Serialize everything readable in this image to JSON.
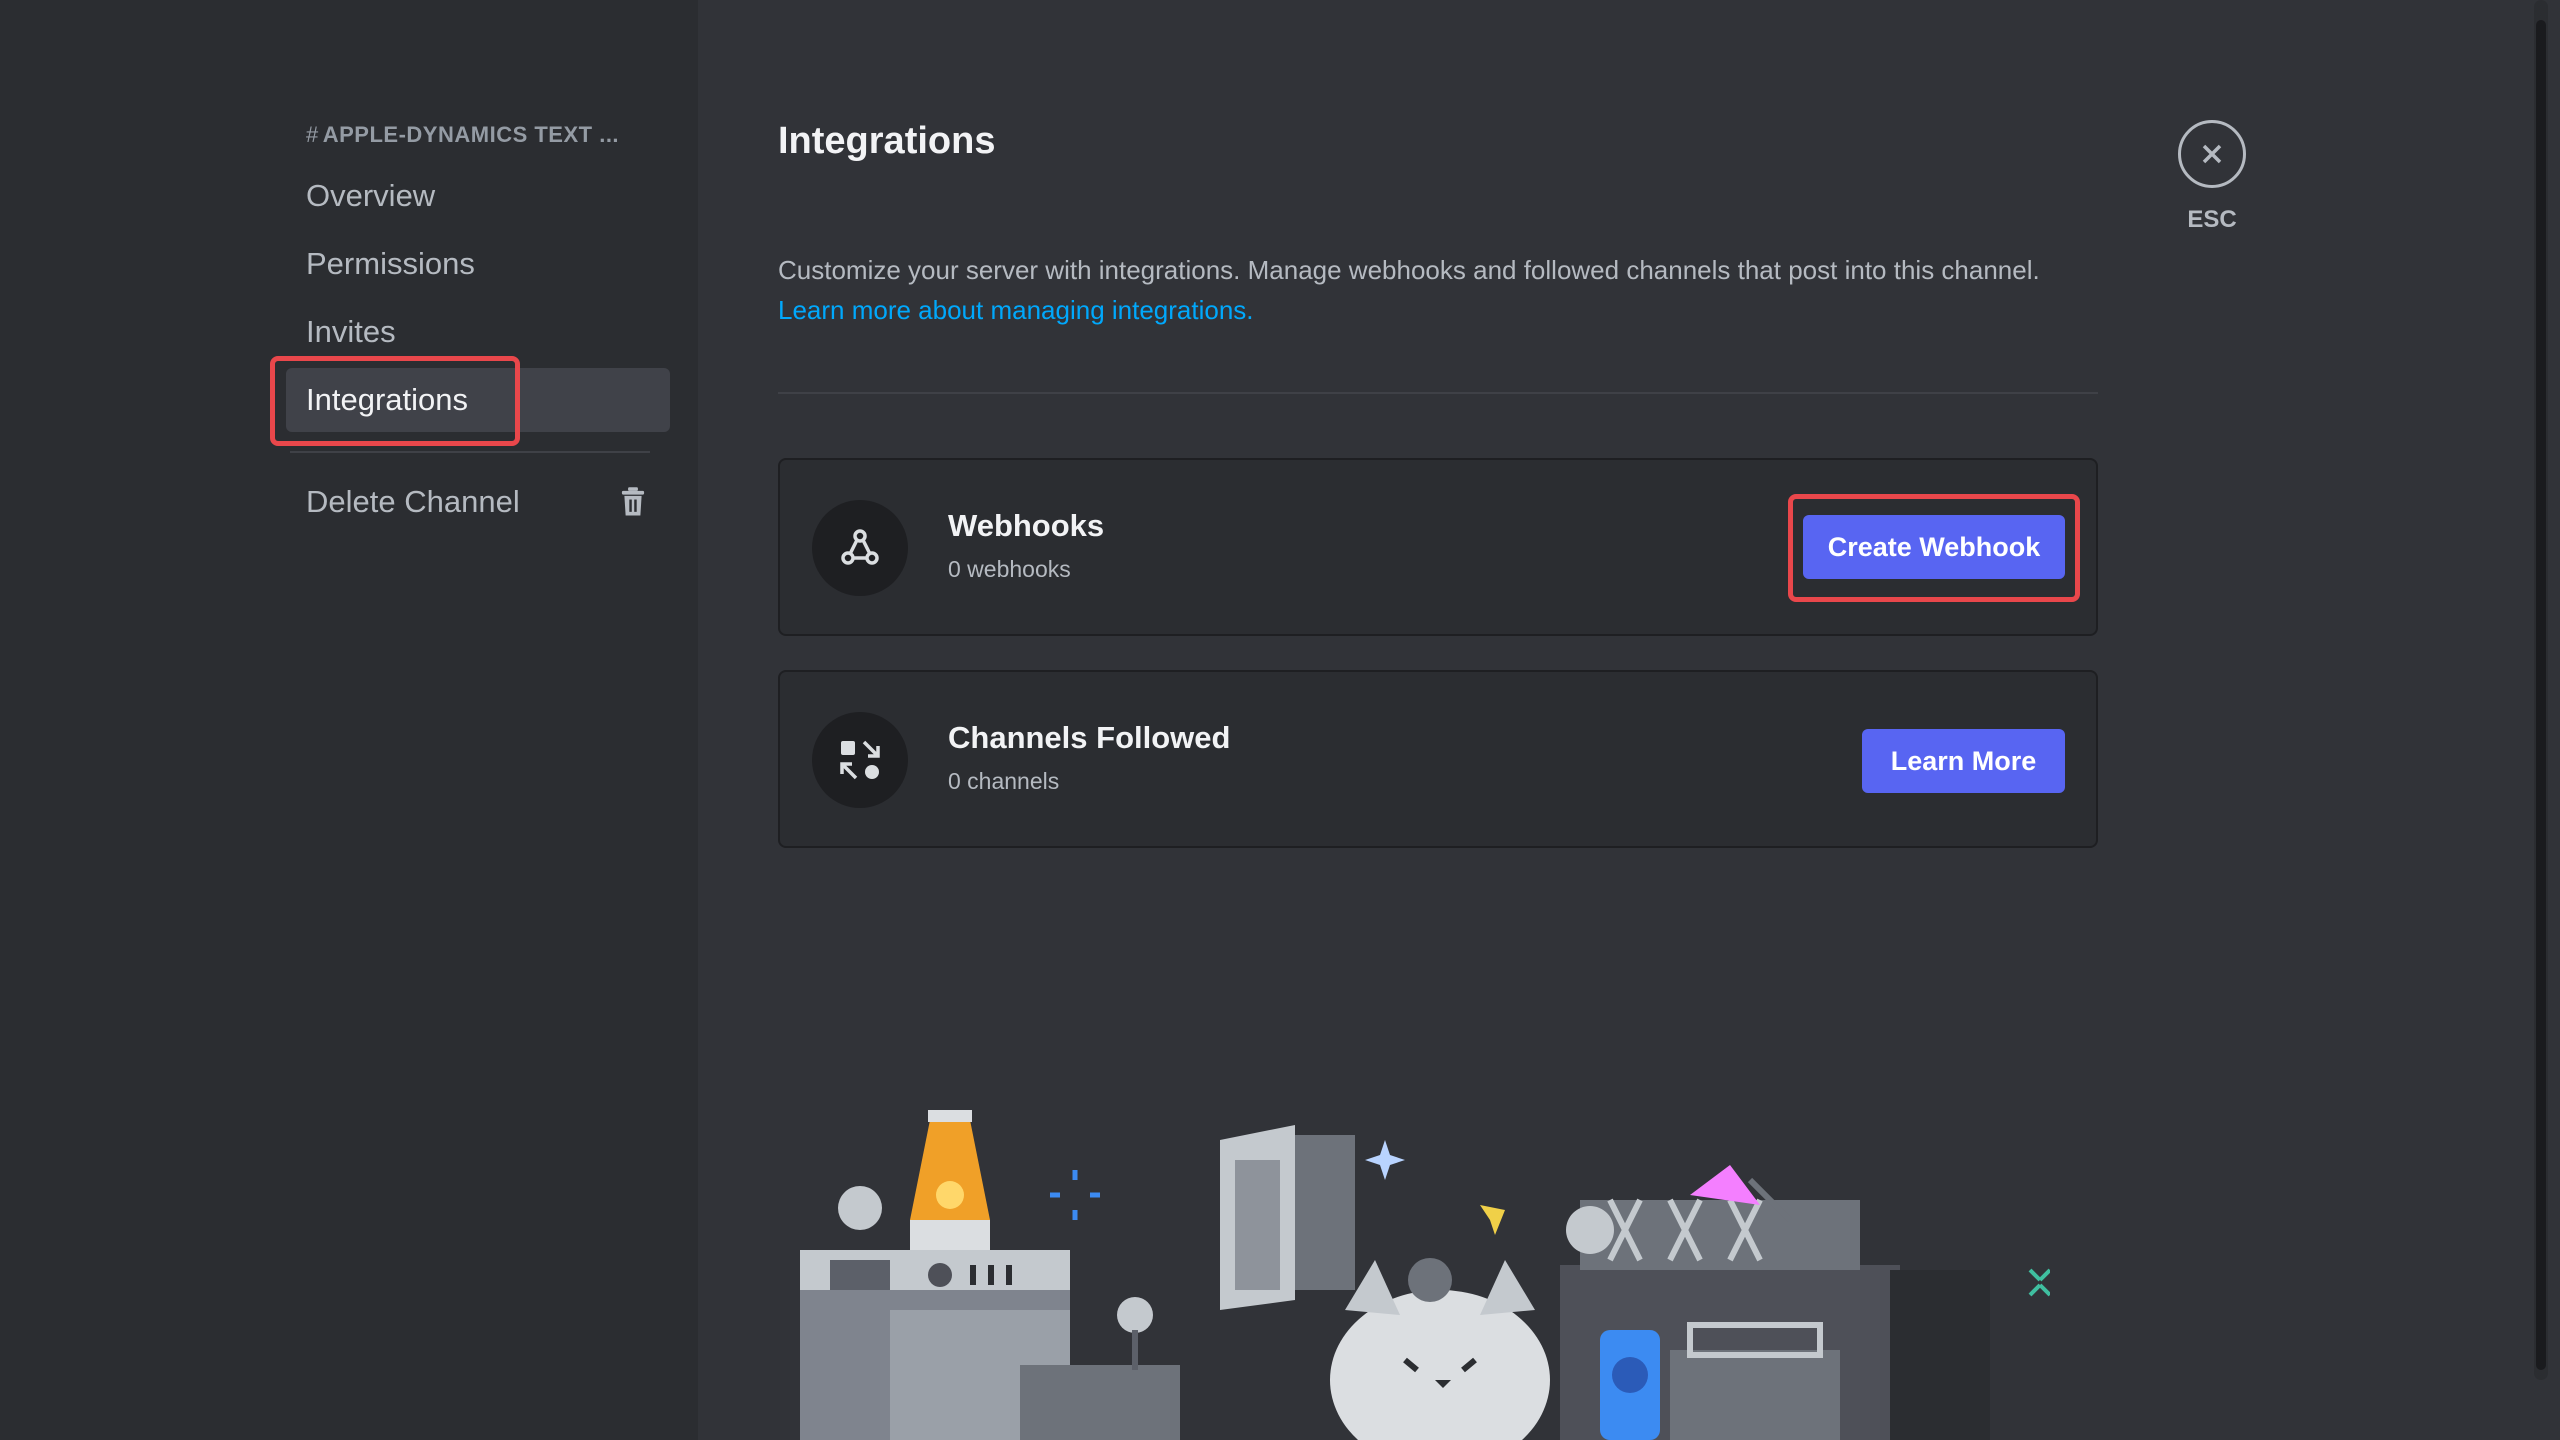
{
  "window": {
    "controls": [
      "close",
      "minimize",
      "maximize"
    ]
  },
  "sidebar": {
    "header": {
      "hash": "#",
      "text": "APPLE-DYNAMICS TEXT ..."
    },
    "items": [
      {
        "label": "Overview"
      },
      {
        "label": "Permissions"
      },
      {
        "label": "Invites"
      },
      {
        "label": "Integrations",
        "active": true
      }
    ],
    "delete_label": "Delete Channel",
    "delete_icon": "trash-icon"
  },
  "main": {
    "title": "Integrations",
    "description": "Customize your server with integrations. Manage webhooks and followed channels that post into this channel.",
    "link": "Learn more about managing integrations.",
    "cards": [
      {
        "icon": "webhook-icon",
        "title": "Webhooks",
        "subtitle": "0 webhooks",
        "button": "Create Webhook"
      },
      {
        "icon": "channels-followed-icon",
        "title": "Channels Followed",
        "subtitle": "0 channels",
        "button": "Learn More"
      }
    ]
  },
  "close": {
    "icon": "close-icon",
    "label": "ESC"
  },
  "colors": {
    "accent": "#5865f2",
    "link": "#00a8fc",
    "highlight": "#e9474b"
  }
}
